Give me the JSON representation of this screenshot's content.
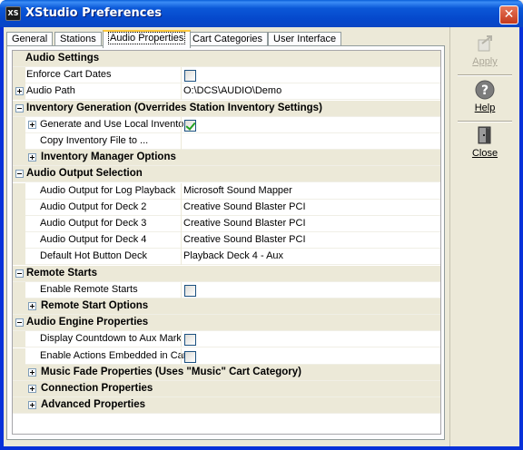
{
  "window": {
    "title": "XStudio Preferences",
    "app_icon_text": "XS",
    "close_glyph": "✕"
  },
  "tabs": [
    {
      "label": "General",
      "active": false
    },
    {
      "label": "Stations",
      "active": false
    },
    {
      "label": "Audio Properties",
      "active": true
    },
    {
      "label": "Cart Categories",
      "active": false
    },
    {
      "label": "User Interface",
      "active": false
    }
  ],
  "grid": {
    "rows": [
      {
        "kind": "cat",
        "label": "Audio Settings",
        "expander": "none",
        "indent": 0
      },
      {
        "kind": "prop",
        "label": "Enforce Cart Dates",
        "indent": 0,
        "value_type": "checkbox",
        "checked": false
      },
      {
        "kind": "prop",
        "label": "Audio Path",
        "indent": 0,
        "expander": "plus",
        "value_type": "text",
        "value": "O:\\DCS\\AUDIO\\Demo"
      },
      {
        "kind": "cat",
        "label": "Inventory Generation (Overrides Station Inventory Settings)",
        "expander": "minus",
        "indent": 0
      },
      {
        "kind": "prop",
        "label": "Generate and Use Local Inventory",
        "indent": 1,
        "expander": "plus",
        "value_type": "checkbox",
        "checked": true
      },
      {
        "kind": "prop",
        "label": "Copy Inventory File to ...",
        "indent": 1,
        "value_type": "text",
        "value": ""
      },
      {
        "kind": "cat",
        "label": "Inventory Manager Options",
        "expander": "plus",
        "indent": 1
      },
      {
        "kind": "cat",
        "label": "Audio Output Selection",
        "expander": "minus",
        "indent": 0
      },
      {
        "kind": "prop",
        "label": "Audio Output for Log Playback",
        "indent": 1,
        "value_type": "text",
        "value": "Microsoft Sound Mapper"
      },
      {
        "kind": "prop",
        "label": "Audio Output for Deck 2",
        "indent": 1,
        "value_type": "text",
        "value": "Creative Sound Blaster PCI"
      },
      {
        "kind": "prop",
        "label": "Audio Output for Deck 3",
        "indent": 1,
        "value_type": "text",
        "value": "Creative Sound Blaster PCI"
      },
      {
        "kind": "prop",
        "label": "Audio Output for Deck 4",
        "indent": 1,
        "value_type": "text",
        "value": "Creative Sound Blaster PCI"
      },
      {
        "kind": "prop",
        "label": "Default Hot Button Deck",
        "indent": 1,
        "value_type": "text",
        "value": "Playback Deck 4 - Aux"
      },
      {
        "kind": "cat",
        "label": "Remote Starts",
        "expander": "minus",
        "indent": 0
      },
      {
        "kind": "prop",
        "label": "Enable Remote Starts",
        "indent": 1,
        "value_type": "checkbox",
        "checked": false
      },
      {
        "kind": "cat",
        "label": "Remote Start Options",
        "expander": "plus",
        "indent": 1
      },
      {
        "kind": "cat",
        "label": "Audio Engine Properties",
        "expander": "minus",
        "indent": 0
      },
      {
        "kind": "prop",
        "label": "Display Countdown to Aux Mark",
        "indent": 1,
        "value_type": "checkbox",
        "checked": false
      },
      {
        "kind": "prop",
        "label": "Enable Actions Embedded in Carts",
        "indent": 1,
        "value_type": "checkbox",
        "checked": false
      },
      {
        "kind": "cat",
        "label": "Music Fade Properties (Uses \"Music\" Cart Category)",
        "expander": "plus",
        "indent": 1
      },
      {
        "kind": "cat",
        "label": "Connection Properties",
        "expander": "plus",
        "indent": 1
      },
      {
        "kind": "cat",
        "label": "Advanced Properties",
        "expander": "plus",
        "indent": 1
      }
    ]
  },
  "toolbar": {
    "apply": {
      "label": "Apply",
      "icon": "apply-icon",
      "enabled": false
    },
    "help": {
      "label": "Help",
      "icon": "help-icon",
      "enabled": true
    },
    "close": {
      "label": "Close",
      "icon": "door-close-icon",
      "enabled": true
    }
  },
  "colors": {
    "titlebar": "#0548cc",
    "face": "#ece9d8",
    "active_tab_accent": "#ffc83c",
    "check": "#21a121"
  }
}
